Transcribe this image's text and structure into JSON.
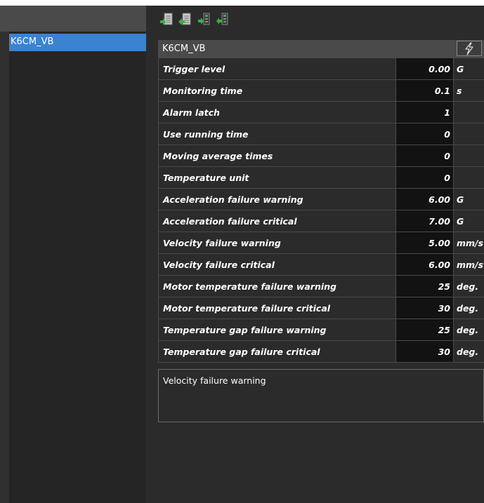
{
  "sidebar": {
    "items": [
      {
        "label": "K6CM_VB",
        "selected": true
      }
    ]
  },
  "toolbar": {
    "buttons": [
      "download-list-icon",
      "upload-list-icon",
      "download-device-icon",
      "upload-device-icon"
    ]
  },
  "panel": {
    "title": "K6CM_VB",
    "action_icon": "lightning-icon",
    "rows": [
      {
        "name": "Trigger level",
        "value": "0.00",
        "unit": "G"
      },
      {
        "name": "Monitoring time",
        "value": "0.1",
        "unit": "s"
      },
      {
        "name": "Alarm latch",
        "value": "1",
        "unit": ""
      },
      {
        "name": "Use running time",
        "value": "0",
        "unit": ""
      },
      {
        "name": "Moving average times",
        "value": "0",
        "unit": ""
      },
      {
        "name": "Temperature unit",
        "value": "0",
        "unit": ""
      },
      {
        "name": "Acceleration failure warning",
        "value": "6.00",
        "unit": "G"
      },
      {
        "name": "Acceleration failure critical",
        "value": "7.00",
        "unit": "G"
      },
      {
        "name": "Velocity failure warning",
        "value": "5.00",
        "unit": "mm/s"
      },
      {
        "name": "Velocity failure critical",
        "value": "6.00",
        "unit": "mm/s"
      },
      {
        "name": "Motor temperature failure warning",
        "value": "25",
        "unit": "deg."
      },
      {
        "name": "Motor temperature failure critical",
        "value": "30",
        "unit": "deg."
      },
      {
        "name": "Temperature gap failure warning",
        "value": "25",
        "unit": "deg."
      },
      {
        "name": "Temperature gap failure critical",
        "value": "30",
        "unit": "deg."
      }
    ]
  },
  "description": {
    "text": "Velocity failure warning"
  },
  "colors": {
    "selection": "#3b82d0",
    "background": "#2b2b2b",
    "value_cell": "#121212",
    "icon_green": "#3cb043"
  }
}
